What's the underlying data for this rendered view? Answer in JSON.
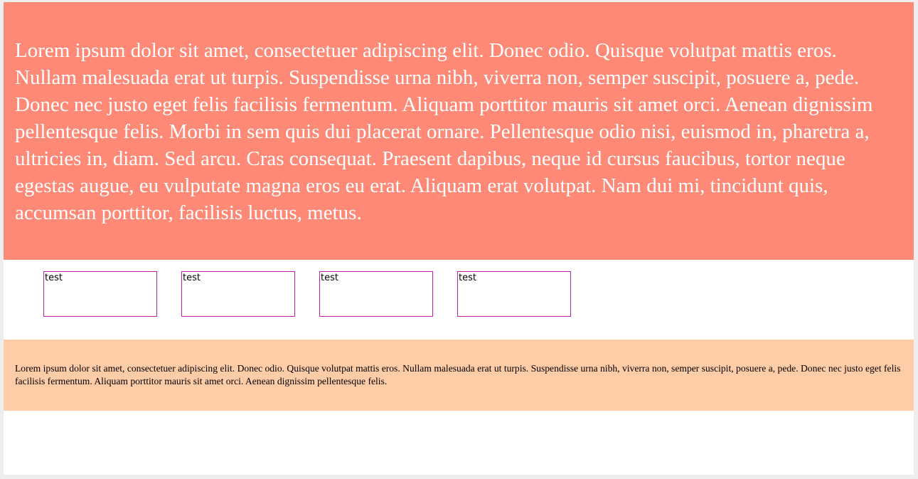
{
  "hero": {
    "text": "Lorem ipsum dolor sit amet, consectetuer adipiscing elit. Donec odio. Quisque volutpat mattis eros. Nullam malesuada erat ut turpis. Suspendisse urna nibh, viverra non, semper suscipit, posuere a, pede. Donec nec justo eget felis facilisis fermentum. Aliquam porttitor mauris sit amet orci. Aenean dignissim pellentesque felis. Morbi in sem quis dui placerat ornare. Pellentesque odio nisi, euismod in, pharetra a, ultricies in, diam. Sed arcu. Cras consequat. Praesent dapibus, neque id cursus faucibus, tortor neque egestas augue, eu vulputate magna eros eu erat. Aliquam erat volutpat. Nam dui mi, tincidunt quis, accumsan porttitor, facilisis luctus, metus."
  },
  "boxes": [
    {
      "label": "test"
    },
    {
      "label": "test"
    },
    {
      "label": "test"
    },
    {
      "label": "test"
    }
  ],
  "footer": {
    "text": "Lorem ipsum dolor sit amet, consectetuer adipiscing elit. Donec odio. Quisque volutpat mattis eros. Nullam malesuada erat ut turpis. Suspendisse urna nibh, viverra non, semper suscipit, posuere a, pede. Donec nec justo eget felis facilisis fermentum. Aliquam porttitor mauris sit amet orci. Aenean dignissim pellentesque felis."
  },
  "colors": {
    "hero_background": "#ff8977",
    "footer_background": "#ffcca8",
    "box_border": "#c020b0"
  }
}
